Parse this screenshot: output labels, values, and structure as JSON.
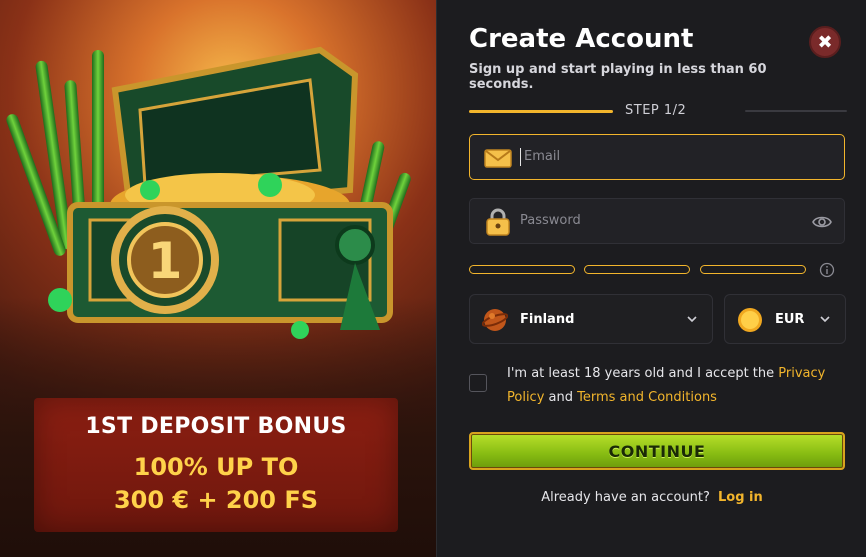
{
  "promo": {
    "bonus_title": "1ST DEPOSIT BONUS",
    "bonus_line1": "100% UP TO",
    "bonus_line2": "300 € + 200 FS",
    "chest_number": "1"
  },
  "form": {
    "title": "Create Account",
    "subtitle": "Sign up and start playing in less than 60 seconds.",
    "step_label": "STEP  1/2",
    "email_placeholder": "Email",
    "password_placeholder": "Password",
    "country": "Finland",
    "currency": "EUR",
    "consent_text_1": "I'm at least 18 years old and I accept the ",
    "consent_link_privacy": "Privacy Policy",
    "consent_and": " and ",
    "consent_link_terms": "Terms and Conditions",
    "continue_label": "CONTINUE",
    "already_text": "Already have an account?",
    "login_label": "Log in",
    "close_symbol": "✖"
  },
  "colors": {
    "accent": "#f2b52c",
    "button_green": "#86bb12",
    "panel_bg": "#1c1c1f",
    "bonus_bg": "#7a1b0f"
  },
  "icons": [
    "close-icon",
    "envelope-icon",
    "lock-icon",
    "eye-icon",
    "info-icon",
    "globe-flag-icon",
    "coin-icon",
    "chevron-down-icon"
  ]
}
